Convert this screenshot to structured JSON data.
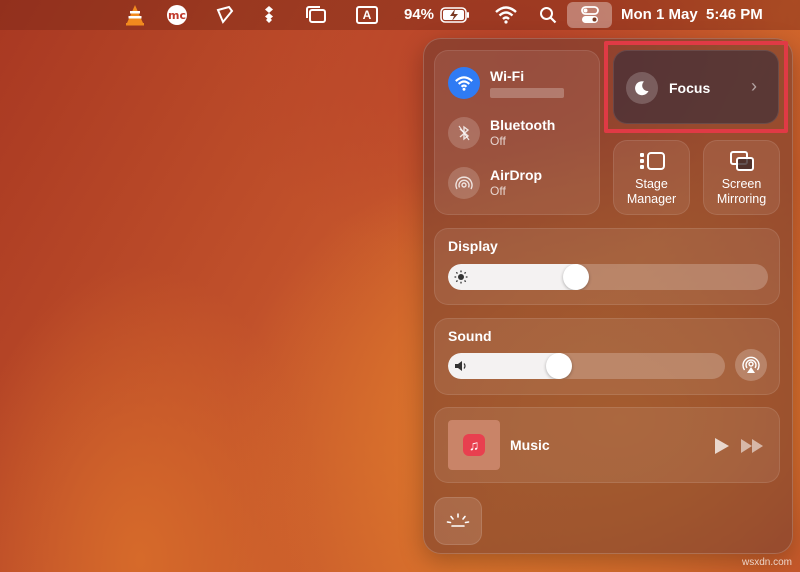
{
  "menubar": {
    "battery_percent": "94%",
    "input_source": "A",
    "datetime": "Mon 1 May  5:46 PM",
    "icons": [
      "vlc-icon",
      "mc-icon",
      "pen-icon",
      "dropbox-icon",
      "window-icon",
      "input-source-icon",
      "battery-charging-icon",
      "wifi-icon",
      "search-icon",
      "control-center-icon"
    ]
  },
  "control_center": {
    "connectivity": {
      "wifi": {
        "label": "Wi-Fi",
        "status": ""
      },
      "bluetooth": {
        "label": "Bluetooth",
        "status": "Off"
      },
      "airdrop": {
        "label": "AirDrop",
        "status": "Off"
      }
    },
    "focus": {
      "label": "Focus"
    },
    "stage_manager": {
      "label_line1": "Stage",
      "label_line2": "Manager"
    },
    "screen_mirroring": {
      "label_line1": "Screen",
      "label_line2": "Mirroring"
    },
    "display": {
      "title": "Display",
      "brightness": 0.4
    },
    "sound": {
      "title": "Sound",
      "volume": 0.4
    },
    "music": {
      "label": "Music"
    }
  },
  "watermark": "wsxdn.com",
  "colors": {
    "accent": "#2f7bf4",
    "highlight": "#e03a45",
    "music_red": "#e8404f"
  }
}
